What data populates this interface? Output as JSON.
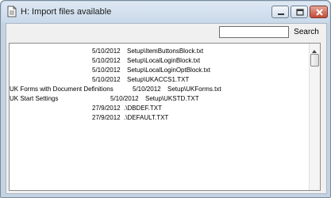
{
  "window": {
    "title": "H: Import files available"
  },
  "toolbar": {
    "search_value": "",
    "search_button_label": "Search"
  },
  "files": [
    {
      "name": "",
      "date": "5/10/2012",
      "path": "Setup\\ItemButtonsBlock.txt"
    },
    {
      "name": "",
      "date": "5/10/2012",
      "path": "Setup\\LocalLoginBlock.txt"
    },
    {
      "name": "",
      "date": "5/10/2012",
      "path": "Setup\\LocalLoginOptBlock.txt"
    },
    {
      "name": "",
      "date": "5/10/2012",
      "path": "Setup\\UKACCS1.TXT"
    },
    {
      "name": "UK Forms with Document Definitions",
      "date": "5/10/2012",
      "path": "Setup\\UKForms.txt"
    },
    {
      "name": "UK Start Settings",
      "date": "5/10/2012",
      "path": "Setup\\UKSTD.TXT"
    },
    {
      "name": "",
      "date": "27/9/2012",
      "path": ".\\DBDEF.TXT"
    },
    {
      "name": "",
      "date": "27/9/2012",
      "path": ".\\DEFAULT.TXT"
    }
  ],
  "icons": {
    "app": "document-icon",
    "minimize": "minimize-icon",
    "maximize": "maximize-icon",
    "close": "close-icon",
    "scroll_up": "scroll-up-arrow-icon"
  }
}
